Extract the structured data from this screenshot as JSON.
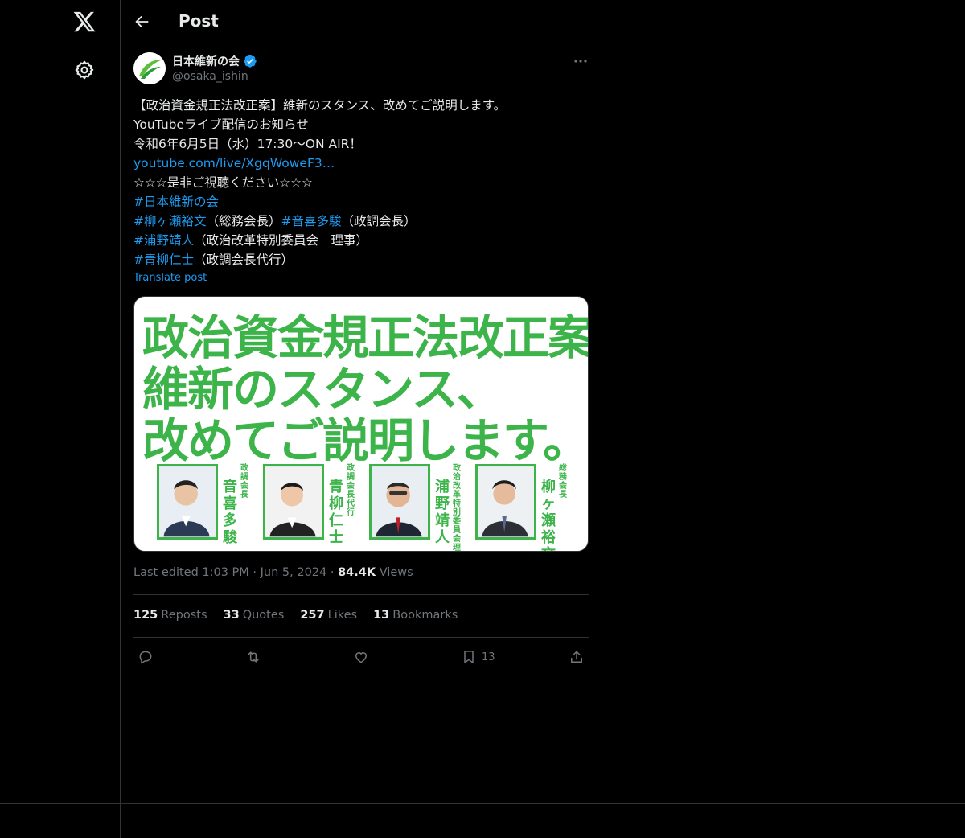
{
  "nav": {
    "logo_icon": "x-logo-icon",
    "settings_icon": "gear-icon"
  },
  "header": {
    "title": "Post",
    "back_icon": "arrow-left-icon"
  },
  "author": {
    "display_name": "日本維新の会",
    "handle": "@osaka_ishin",
    "verified": true,
    "avatar_icon": "leaf-logo-icon"
  },
  "post": {
    "lines": [
      {
        "text": "【政治資金規正法改正案】維新のスタンス、改めてご説明します。"
      },
      {
        "text": "YouTubeライブ配信のお知らせ"
      },
      {
        "text": "令和6年6月5日（水）17:30〜ON AIR！"
      },
      {
        "link": "youtube.com/live/XgqWoweF3…"
      },
      {
        "text": "☆☆☆是非ご視聴ください☆☆☆"
      }
    ],
    "hashtag_line1": "#日本維新の会",
    "hashtag_line2_a": "#柳ヶ瀬裕文",
    "hashtag_line2_a_suffix": "（総務会長）",
    "hashtag_line2_b": "#音喜多駿",
    "hashtag_line2_b_suffix": "（政調会長）",
    "hashtag_line3": "#浦野靖人",
    "hashtag_line3_suffix": "（政治改革特別委員会　理事）",
    "hashtag_line4": "#青柳仁士",
    "hashtag_line4_suffix": "（政調会長代行）",
    "translate": "Translate post"
  },
  "media": {
    "headline1": "政治資金規正法改正案",
    "headline2": "維新のスタンス、",
    "headline3": "改めてご説明します。",
    "people": [
      {
        "name": "音喜多駿",
        "role": "政調会長"
      },
      {
        "name": "青柳仁士",
        "role": "政調会長代行"
      },
      {
        "name": "浦野靖人",
        "role": "政治改革特別委員会理事"
      },
      {
        "name": "柳ヶ瀬裕文",
        "role": "総務会長"
      }
    ]
  },
  "meta": {
    "edited": "Last edited 1:03 PM",
    "sep": "·",
    "date": "Jun 5, 2024",
    "views_count": "84.4K",
    "views_label": "Views"
  },
  "stats": {
    "reposts": {
      "count": "125",
      "label": "Reposts"
    },
    "quotes": {
      "count": "33",
      "label": "Quotes"
    },
    "likes": {
      "count": "257",
      "label": "Likes"
    },
    "bookmarks": {
      "count": "13",
      "label": "Bookmarks"
    }
  },
  "actions": {
    "reply_icon": "reply-icon",
    "repost_icon": "repost-icon",
    "like_icon": "heart-icon",
    "bookmark_icon": "bookmark-icon",
    "bookmark_count": "13",
    "share_icon": "share-icon"
  },
  "colors": {
    "background": "#000000",
    "text": "#e7e9ea",
    "muted": "#71767b",
    "link": "#1d9bf0",
    "border": "#2f3336",
    "brand_green": "#3cb44a"
  }
}
